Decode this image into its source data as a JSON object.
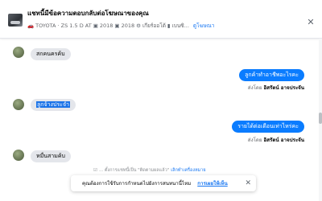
{
  "header": {
    "title": "แชทนี้มีข้อความตอบกลับต่อโฆษณาของคุณ",
    "car_icon": "car-icon",
    "vehicle": "TOYOTA · ZS 1.5 D AT",
    "year_1": "2018",
    "year_2": "2018",
    "info_1": "เกียร์ออโต้",
    "info_2": "เบนซิ...",
    "ad_link": "ดูโฆษณา",
    "close_icon": "close-icon"
  },
  "messages": [
    {
      "from": "other",
      "text": "สกคนครค้บ"
    },
    {
      "from": "me",
      "text": "ลูกค้าทำอาชีพอะไรคะ",
      "sent_by_label": "ส่งโดย",
      "sent_by_name": "อิสรัตน์ อาจประจัน"
    },
    {
      "from": "other",
      "text": "ลูกจ้างประจำ",
      "selected": true
    },
    {
      "from": "me",
      "text": "รายได้ต่อเดือนเท่าไหร่คะ",
      "sent_by_label": "ส่งโดย",
      "sent_by_name": "อิสรัตน์ อาจประจัน"
    },
    {
      "from": "other",
      "text": "หมื่นสามค้บ"
    }
  ],
  "system_line": {
    "icon": "info-icon",
    "text": "... ตั้งการแชทนี้เป็น \"ติดตามผลแล้ว\"",
    "link": "เลิกทำเครื่องหมาย"
  },
  "toast": {
    "message": "คุณต้องการใช้รับการกำหนดไปยังการสนทนานี้ไหม",
    "manage_link": "การเผยให้เห็น"
  },
  "colors": {
    "accent": "#0a7cff",
    "link": "#1877f2",
    "incoming_bubble": "#e4e6eb"
  }
}
